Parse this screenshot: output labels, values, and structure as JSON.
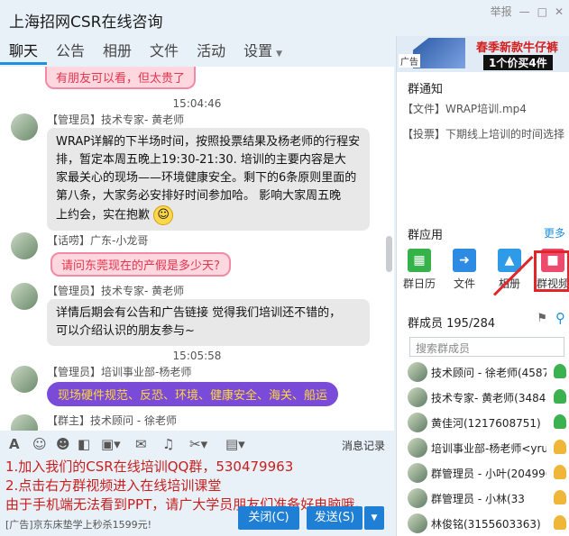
{
  "window": {
    "title": "上海招网CSR在线咨询",
    "report_label": "举报"
  },
  "tabs": [
    {
      "label": "聊天"
    },
    {
      "label": "公告"
    },
    {
      "label": "相册"
    },
    {
      "label": "文件"
    },
    {
      "label": "活动"
    },
    {
      "label": "设置"
    }
  ],
  "chat": {
    "top_partial": "有朋友可以看，但太贵了",
    "messages": [
      {
        "time": "15:04:46",
        "sender": "【管理员】技术专家- 黄老师",
        "lines": [
          "WRAP详解的下半场时间，按照投票结果及杨老师的行程安",
          "排，暂定本周五晚上19:30-21:30.   培训的主要内容是大",
          "家最关心的现场——环境健康安全。剩下的6条原则里面的",
          "第八条，大家务必安排好时间参加哈。  影响大家周五晚",
          "上约会，实在抱歉"
        ]
      },
      {
        "sender": "【话唠】广东-小龙哥",
        "text": "请问东莞现在的产假是多少天?"
      },
      {
        "sender": "【管理员】技术专家- 黄老师",
        "lines": [
          "详情后期会有公告和广告链接   觉得我们培训还不错的，",
          "可以介绍认识的朋友参与~"
        ]
      },
      {
        "time": "15:05:58",
        "sender": "【管理员】培训事业部-杨老师",
        "text": "现场硬件规范、反恐、环境、健康安全、海关、船运"
      },
      {
        "sender": "【群主】技术顾问 - 徐老师"
      }
    ]
  },
  "toolbar": {
    "history_label": "消息记录"
  },
  "composer": {
    "lines": [
      "1.加入我们的CSR在线培训QQ群，530479963",
      "2.点击右方群视频进入在线培训课堂",
      "由于手机端无法看到PPT，请广大学员朋友们准备好电脑哦。"
    ]
  },
  "footer": {
    "ad": "[广告]京东床垫学上秒杀1599元!",
    "close_label": "关闭(C)",
    "send_label": "发送(S)"
  },
  "banner": {
    "tag": "广告",
    "headline": "春季新款牛仔裤",
    "promo": "1个价买4件"
  },
  "notice": {
    "title": "群通知",
    "items": [
      "【文件】WRAP培训.mp4",
      "【投票】下期线上培训的时间选择"
    ]
  },
  "apps": {
    "title": "群应用",
    "more": "更多",
    "items": [
      "群日历",
      "文件",
      "相册",
      "群视频"
    ]
  },
  "members": {
    "title": "群成员 195/284",
    "search_placeholder": "搜索群成员",
    "list": [
      {
        "name": "技术顾问 - 徐老师(4587"
      },
      {
        "name": "技术专家- 黄老师(34842"
      },
      {
        "name": "黄佳河(1217608751)"
      },
      {
        "name": "培训事业部-杨老师<yru"
      },
      {
        "name": "群管理员 - 小叶(204990"
      },
      {
        "name": "群管理员 - 小林(33"
      },
      {
        "name": "林俊铭(3155603363)"
      }
    ]
  }
}
